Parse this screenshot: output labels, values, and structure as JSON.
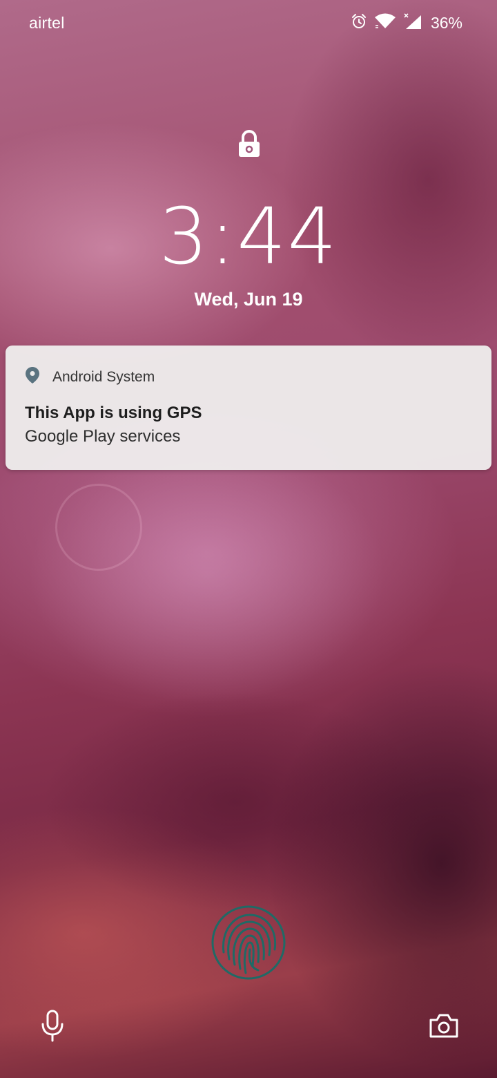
{
  "status_bar": {
    "carrier": "airtel",
    "battery": "36%",
    "icons": [
      "alarm-icon",
      "wifi-icon",
      "signal-icon"
    ]
  },
  "lock_screen": {
    "time": "3:44",
    "date": "Wed, Jun 19"
  },
  "notification": {
    "app_name": "Android System",
    "title": "This App is using GPS",
    "body": "Google Play services",
    "icon": "location-pin-icon",
    "icon_color": "#5a7380"
  },
  "bottom_actions": {
    "left_icon": "microphone-icon",
    "right_icon": "camera-icon",
    "fingerprint_icon": "fingerprint-icon",
    "fingerprint_color": "#1f6a66"
  }
}
